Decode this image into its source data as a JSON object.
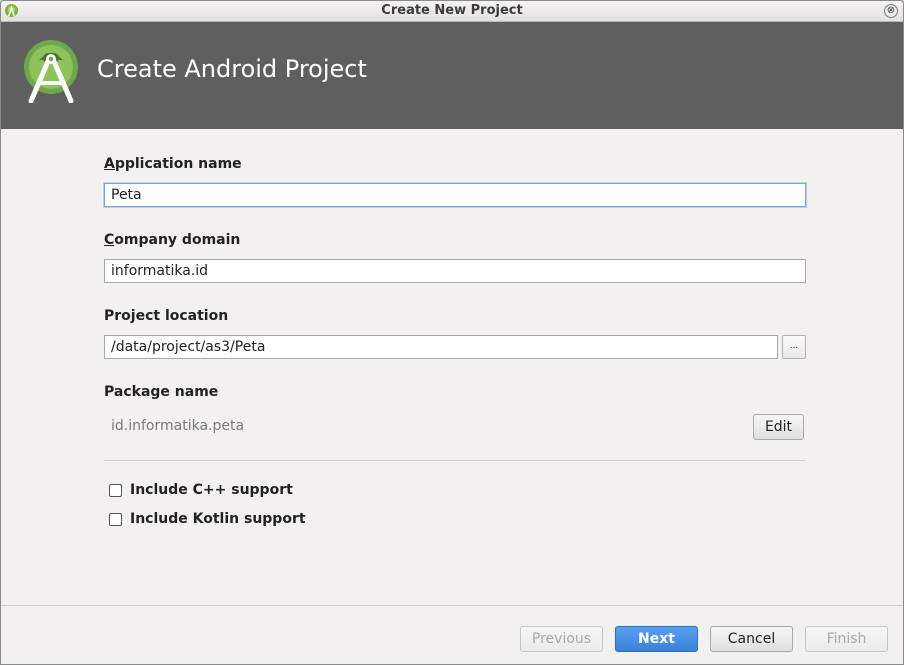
{
  "window": {
    "title": "Create New Project",
    "header_title": "Create Android Project",
    "close_glyph": "⊗"
  },
  "form": {
    "app_name": {
      "label": "Application name",
      "accesskey": "A",
      "value": "Peta"
    },
    "company_domain": {
      "label": "Company domain",
      "accesskey": "C",
      "value": "informatika.id"
    },
    "project_location": {
      "label": "Project location",
      "value": "/data/project/as3/Peta",
      "browse_label": "..."
    },
    "package_name": {
      "label": "Package name",
      "value": "id.informatika.peta",
      "edit_label": "Edit"
    }
  },
  "options": {
    "cpp": {
      "label": "Include C++ support",
      "checked": false
    },
    "kotlin": {
      "label": "Include Kotlin support",
      "checked": false
    }
  },
  "footer": {
    "previous": "Previous",
    "next": "Next",
    "cancel": "Cancel",
    "finish": "Finish"
  },
  "colors": {
    "header_bg": "#5f5f5f",
    "android_green": "#9ccc65",
    "primary_button": "#3b82d9"
  },
  "icons": {
    "app_icon": "android-studio-icon",
    "header_logo": "android-studio-logo"
  }
}
